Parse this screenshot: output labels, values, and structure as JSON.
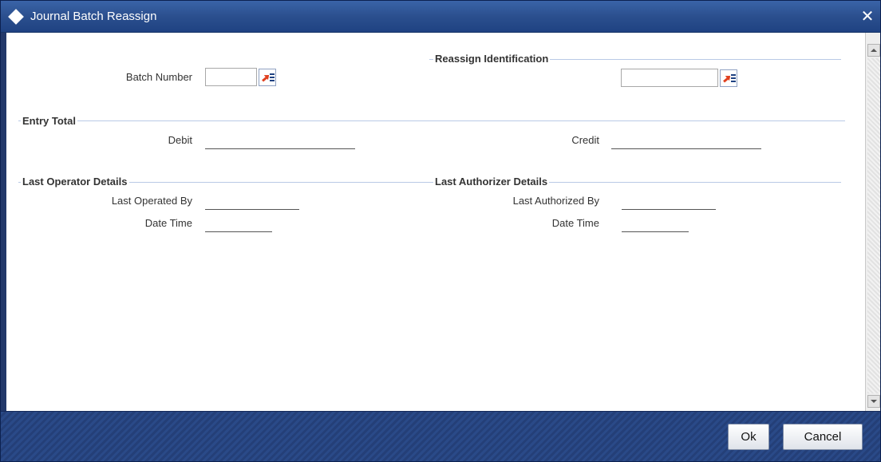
{
  "window": {
    "title": "Journal Batch Reassign",
    "close_glyph": "✕"
  },
  "batch": {
    "label": "Batch Number",
    "value": ""
  },
  "reassign": {
    "legend": "Reassign Identification",
    "value": ""
  },
  "entry_total": {
    "legend": "Entry Total",
    "debit_label": "Debit",
    "debit_value": "",
    "credit_label": "Credit",
    "credit_value": ""
  },
  "operator": {
    "legend": "Last Operator Details",
    "by_label": "Last Operated By",
    "by_value": "",
    "datetime_label": "Date Time",
    "datetime_value": ""
  },
  "authorizer": {
    "legend": "Last Authorizer Details",
    "by_label": "Last Authorized By",
    "by_value": "",
    "datetime_label": "Date Time",
    "datetime_value": ""
  },
  "footer": {
    "ok_label": "Ok",
    "cancel_label": "Cancel"
  },
  "icons": {
    "title": "diamond-icon",
    "lookup": "list-lookup-icon",
    "close": "close-icon"
  }
}
